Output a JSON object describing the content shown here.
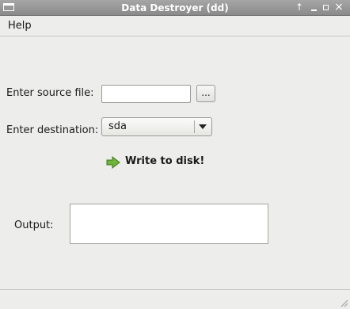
{
  "window": {
    "title": "Data Destroyer (dd)"
  },
  "menu": {
    "items": [
      {
        "label": "Help"
      }
    ]
  },
  "form": {
    "source_label": "Enter source file:",
    "source_value": "",
    "browse_label": "...",
    "destination_label": "Enter destination:",
    "destination_value": "sda",
    "write_label": "Write to disk!",
    "output_label": "Output:",
    "output_value": ""
  },
  "icons": {
    "window": "window-icon",
    "titlebar_up": "arrow-up-icon",
    "minimize": "minimize-icon",
    "maximize": "maximize-icon",
    "close": "close-icon",
    "write": "green-arrow-right-icon",
    "combo_arrow": "chevron-down-icon",
    "resize": "resize-grip-icon"
  },
  "colors": {
    "titlebar": "#959595",
    "background": "#ededeb",
    "write_icon": "#6fb33b"
  }
}
